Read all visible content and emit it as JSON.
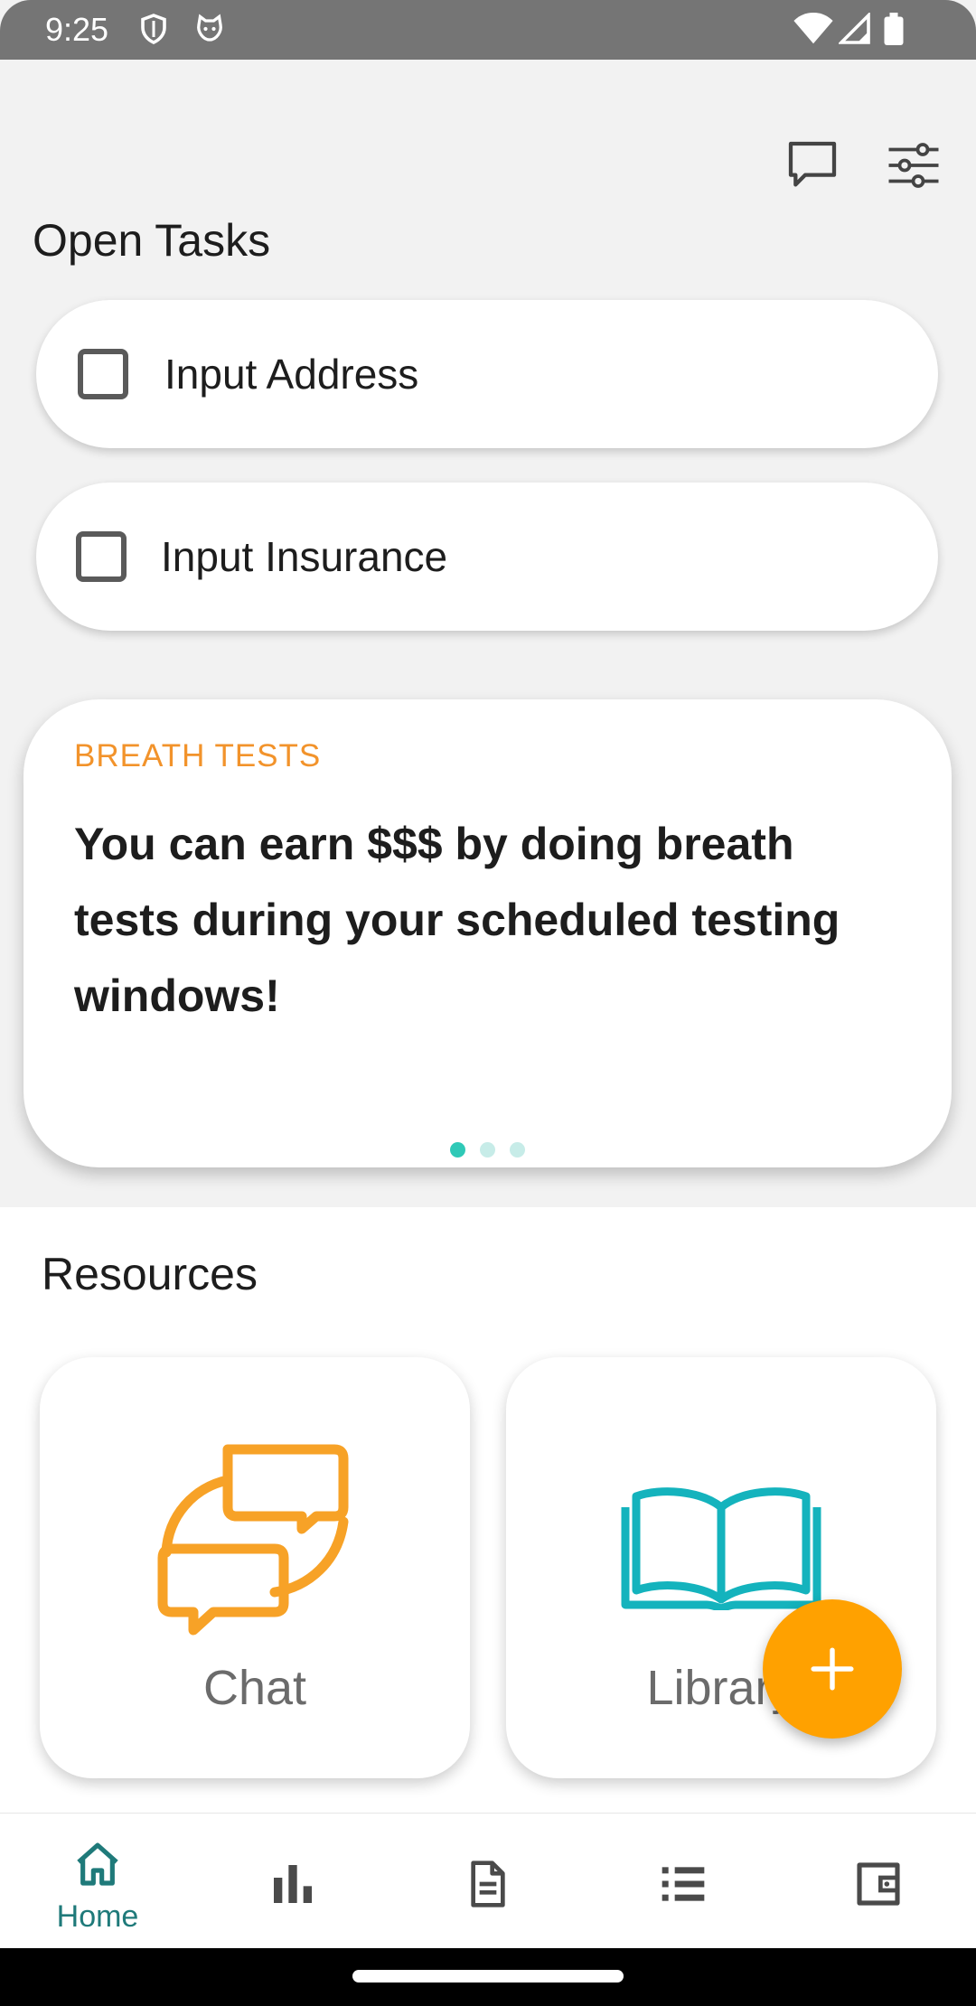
{
  "status_bar": {
    "time": "9:25"
  },
  "header": {
    "chat_icon": "chat-bubble-icon",
    "filter_icon": "tune-icon"
  },
  "open_tasks": {
    "title": "Open Tasks",
    "items": [
      {
        "label": "Input Address",
        "checked": false
      },
      {
        "label": "Input Insurance",
        "checked": false
      }
    ]
  },
  "promo": {
    "label": "BREATH TESTS",
    "body": "You can earn $$$ by doing breath tests during your scheduled testing windows!",
    "page_count": 3,
    "active_page": 1
  },
  "resources": {
    "title": "Resources",
    "items": [
      {
        "label": "Chat",
        "icon": "chat-bubbles-icon",
        "color": "#f7a227"
      },
      {
        "label": "Library",
        "icon": "open-book-icon",
        "color": "#14b3bd"
      }
    ]
  },
  "fab": {
    "icon": "plus-icon",
    "color": "#ffa100"
  },
  "bottom_nav": {
    "items": [
      {
        "label": "Home",
        "icon": "home-icon",
        "active": true
      },
      {
        "label": "",
        "icon": "bar-chart-icon"
      },
      {
        "label": "",
        "icon": "document-icon"
      },
      {
        "label": "",
        "icon": "list-icon"
      },
      {
        "label": "",
        "icon": "wallet-icon"
      }
    ],
    "active_color": "#1f7a7a"
  }
}
